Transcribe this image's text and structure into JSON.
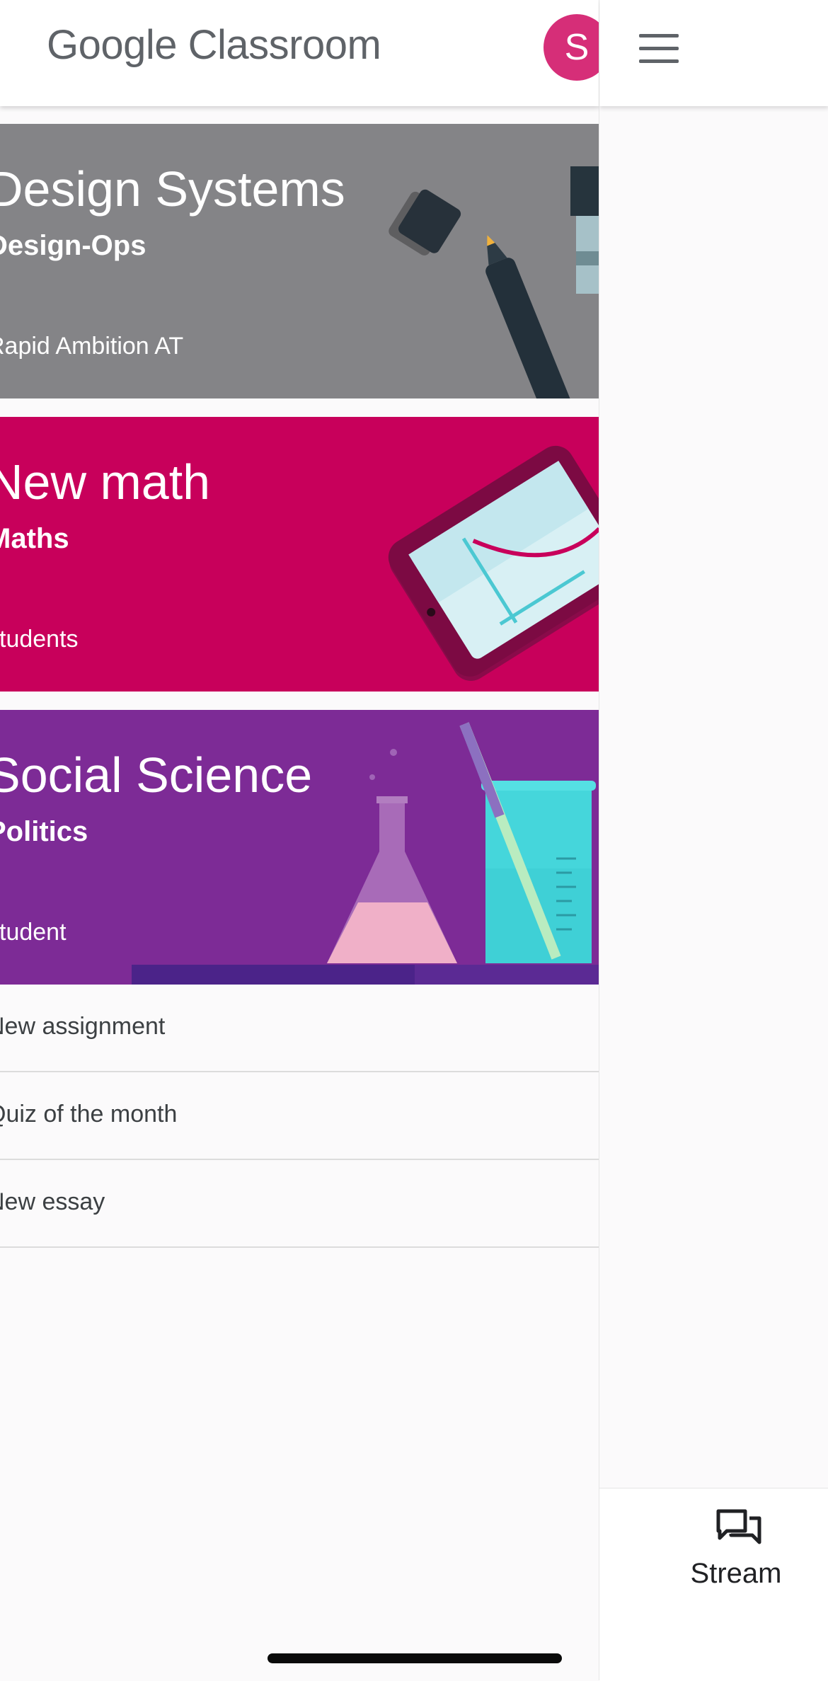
{
  "app": {
    "logo_google": "Google",
    "logo_product": "Classroom",
    "avatar_letter": "S"
  },
  "classes": [
    {
      "title": "Design Systems",
      "section": "Design-Ops",
      "meta": "Rapid Ambition AT",
      "color": "#848487"
    },
    {
      "title": "New math",
      "section": "Maths",
      "meta": "students",
      "color": "#c8005b"
    },
    {
      "title": "Social Science",
      "section": "Politics",
      "meta": "student",
      "color": "#7d2b96"
    }
  ],
  "tasks": [
    {
      "label": "New assignment"
    },
    {
      "label": "Quiz of the month"
    },
    {
      "label": "New essay"
    }
  ],
  "nav": {
    "stream_label": "Stream"
  }
}
